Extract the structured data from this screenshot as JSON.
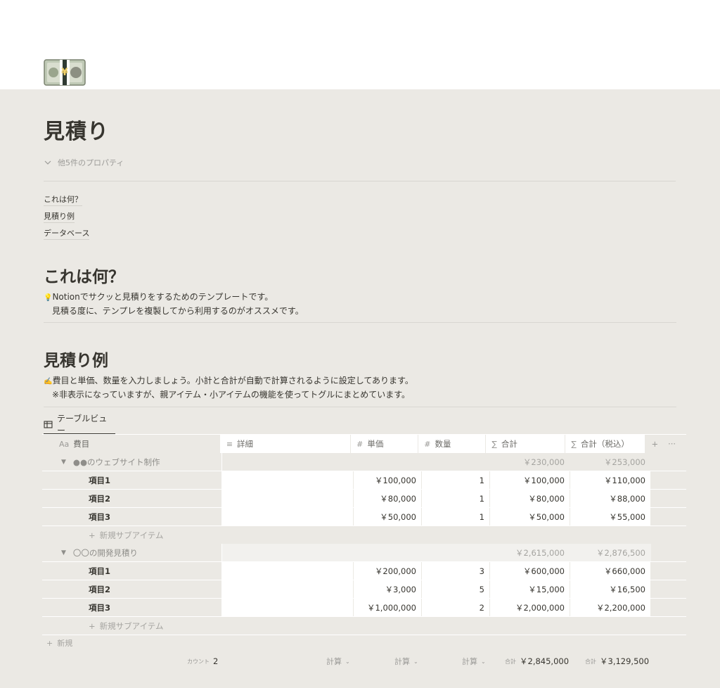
{
  "page": {
    "icon": "yen-banknote-icon",
    "title": "見積り",
    "properties_toggle": "他5件のプロパティ"
  },
  "toc": [
    "これは何？",
    "見積り例",
    "データベース"
  ],
  "section1": {
    "heading": "これは何？",
    "line1_icon": "💡",
    "line1": "Notionでサクッと見積りをするためのテンプレートです。",
    "line2": "見積る度に、テンプレを複製してから利用するのがオススメです。"
  },
  "section2": {
    "heading": "見積り例",
    "line1_icon": "✍️",
    "line1": "費目と単価、数量を入力しましょう。小計と合計が自動で計算されるように設定してあります。",
    "line2": "※非表示になっていますが、親アイテム・小アイテムの機能を使ってトグルにまとめています。"
  },
  "view": {
    "tab_label": "テーブルビュー"
  },
  "table": {
    "columns": [
      {
        "icon": "Aa",
        "label": "費目"
      },
      {
        "icon": "≡",
        "label": "詳細"
      },
      {
        "icon": "#",
        "label": "単価"
      },
      {
        "icon": "#",
        "label": "数量"
      },
      {
        "icon": "∑",
        "label": "合計"
      },
      {
        "icon": "∑",
        "label": "合計（税込）"
      }
    ],
    "add_column": "+",
    "more": "···",
    "groups": [
      {
        "name": "●●のウェブサイト制作",
        "total": "￥230,000",
        "taxed": "￥253,000",
        "items": [
          {
            "name": "項目1",
            "unit": "￥100,000",
            "qty": "1",
            "total": "￥100,000",
            "taxed": "￥110,000"
          },
          {
            "name": "項目2",
            "unit": "￥80,000",
            "qty": "1",
            "total": "￥80,000",
            "taxed": "￥88,000"
          },
          {
            "name": "項目3",
            "unit": "￥50,000",
            "qty": "1",
            "total": "￥50,000",
            "taxed": "￥55,000"
          }
        ],
        "add_sub": "新規サブアイテム"
      },
      {
        "name": "〇〇の開発見積り",
        "total": "￥2,615,000",
        "taxed": "￥2,876,500",
        "items": [
          {
            "name": "項目1",
            "unit": "￥200,000",
            "qty": "3",
            "total": "￥600,000",
            "taxed": "￥660,000"
          },
          {
            "name": "項目2",
            "unit": "￥3,000",
            "qty": "5",
            "total": "￥15,000",
            "taxed": "￥16,500"
          },
          {
            "name": "項目3",
            "unit": "￥1,000,000",
            "qty": "2",
            "total": "￥2,000,000",
            "taxed": "￥2,200,000"
          }
        ],
        "add_sub": "新規サブアイテム"
      }
    ],
    "new_row": "新規",
    "footer": {
      "count_label": "カウント",
      "count_value": "2",
      "calc1": "計算",
      "calc2": "計算",
      "calc3": "計算",
      "sum_label1": "合計",
      "sum_value1": "￥2,845,000",
      "sum_label2": "合計",
      "sum_value2": "￥3,129,500"
    }
  }
}
